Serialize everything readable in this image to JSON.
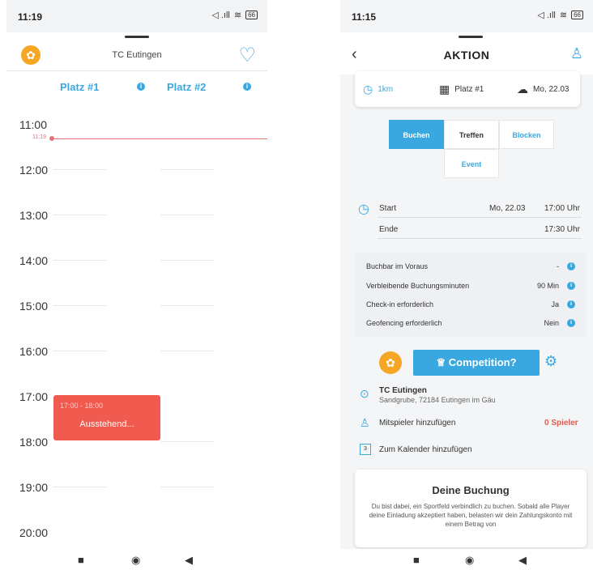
{
  "left": {
    "status": {
      "time": "11:19",
      "signal": "◁ .ıll",
      "wifi": "≋",
      "battery": "66"
    },
    "club_name": "TC Eutingen",
    "courts": [
      {
        "label": "Platz #1"
      },
      {
        "label": "Platz #2"
      }
    ],
    "info_glyph": "i",
    "hours": [
      "11:00",
      "12:00",
      "13:00",
      "14:00",
      "15:00",
      "16:00",
      "17:00",
      "18:00",
      "19:00",
      "20:00"
    ],
    "now_time": "11:19",
    "booking": {
      "time": "17:00 - 18:00",
      "status": "Ausstehend..."
    },
    "nav": {
      "square": "■",
      "circle": "◉",
      "back": "◀"
    }
  },
  "right": {
    "status": {
      "time": "11:15",
      "signal": "◁ .ıll",
      "wifi": "≋",
      "battery": "66"
    },
    "title": "AKTION",
    "back_glyph": "‹",
    "summary": {
      "distance": "1km",
      "court": "Platz #1",
      "date": "Mo, 22.03"
    },
    "tabs": [
      "Buchen",
      "Treffen",
      "Blocken",
      "Event"
    ],
    "start_label": "Start",
    "start_date": "Mo, 22.03",
    "start_time": "17:00 Uhr",
    "end_label": "Ende",
    "end_time": "17:30 Uhr",
    "options": [
      {
        "label": "Buchbar im Voraus",
        "value": "-"
      },
      {
        "label": "Verbleibende Buchungsminuten",
        "value": "90 Min"
      },
      {
        "label": "Check-in erforderlich",
        "value": "Ja"
      },
      {
        "label": "Geofencing erforderlich",
        "value": "Nein"
      }
    ],
    "competition_label": "Competition?",
    "club_name": "TC Eutingen",
    "club_address": "Sandgrube, 72184 Eutingen im Gäu",
    "add_players_label": "Mitspieler hinzufügen",
    "players_count": "0 Spieler",
    "calendar_label": "Zum Kalender hinzufügen",
    "calendar_day": "3",
    "booking_card": {
      "title": "Deine Buchung",
      "text": "Du bist dabei, ein Sportfeld verbindlich zu buchen. Sobald alle Player deine Einladung akzeptiert haben, belasten wir dein Zahlungskonto mit einem Betrag von"
    },
    "nav": {
      "square": "■",
      "circle": "◉",
      "back": "◀"
    }
  },
  "colors": {
    "accent": "#3aa8e0",
    "booking": "#f05a4f",
    "logo": "#f5a623",
    "now": "#e57373"
  }
}
